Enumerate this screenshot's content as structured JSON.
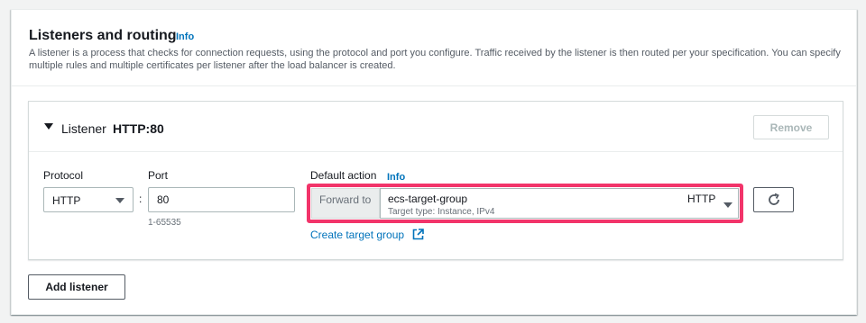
{
  "section": {
    "title": "Listeners and routing",
    "info_label": "Info",
    "description": "A listener is a process that checks for connection requests, using the protocol and port you configure. Traffic received by the listener is then routed per your specification. You can specify multiple rules and multiple certificates per listener after the load balancer is created."
  },
  "listener": {
    "label": "Listener",
    "value": "HTTP:80",
    "remove_label": "Remove",
    "protocol": {
      "label": "Protocol",
      "value": "HTTP",
      "icon": "caret-down-icon"
    },
    "separator": ":",
    "port": {
      "label": "Port",
      "value": "80",
      "hint": "1-65535"
    },
    "default_action": {
      "label": "Default action",
      "info_label": "Info",
      "forward_label": "Forward to",
      "target_group": "ecs-target-group",
      "target_type": "Target type: Instance, IPv4",
      "target_protocol": "HTTP",
      "create_link": "Create target group",
      "create_link_icon": "external-link-icon",
      "refresh_icon": "refresh-icon"
    }
  },
  "add_listener_label": "Add listener",
  "colors": {
    "highlight": "#f2346a",
    "link": "#0073bb",
    "text": "#16191f",
    "muted": "#687078"
  }
}
